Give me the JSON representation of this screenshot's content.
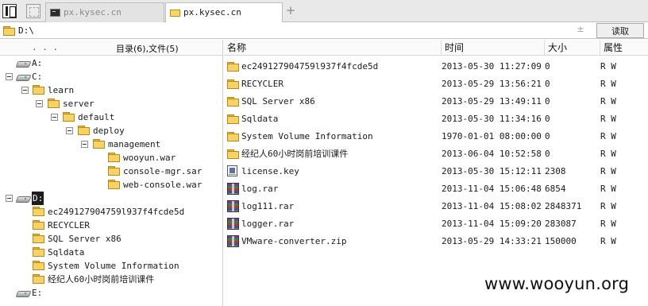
{
  "tabs": [
    {
      "label": "px.kysec.cn",
      "icon": "terminal-icon",
      "active": false
    },
    {
      "label": "px.kysec.cn",
      "icon": "folder-icon",
      "active": true
    }
  ],
  "new_tab_symbol": "+",
  "path": {
    "value": "D:\\",
    "arrows": "±",
    "read_button": "读取"
  },
  "tree_header": {
    "dots": ". . .",
    "summary": "目录(6),文件(5)"
  },
  "tree": [
    {
      "label": "A:",
      "icon": "drive-icon",
      "indent": 0,
      "toggle": false
    },
    {
      "label": "C:",
      "icon": "drive-icon",
      "indent": 0,
      "toggle": true
    },
    {
      "label": "learn",
      "icon": "folder-icon",
      "indent": 1,
      "toggle": true
    },
    {
      "label": "server",
      "icon": "folder-icon",
      "indent": 2,
      "toggle": true
    },
    {
      "label": "default",
      "icon": "folder-icon",
      "indent": 3,
      "toggle": true
    },
    {
      "label": "deploy",
      "icon": "folder-icon",
      "indent": 4,
      "toggle": true
    },
    {
      "label": "management",
      "icon": "folder-icon",
      "indent": 5,
      "toggle": true
    },
    {
      "label": "wooyun.war",
      "icon": "folder-icon",
      "indent": 6,
      "toggle": false
    },
    {
      "label": "console-mgr.sar",
      "icon": "folder-icon",
      "indent": 6,
      "toggle": false
    },
    {
      "label": "web-console.war",
      "icon": "folder-icon",
      "indent": 6,
      "toggle": false
    },
    {
      "label": "D:",
      "icon": "drive-icon",
      "indent": 0,
      "toggle": true,
      "selected": true
    },
    {
      "label": "ec249127904759l937f4fcde5d",
      "icon": "folder-icon",
      "indent": 1,
      "toggle": false
    },
    {
      "label": "RECYCLER",
      "icon": "folder-icon",
      "indent": 1,
      "toggle": false
    },
    {
      "label": "SQL Server x86",
      "icon": "folder-icon",
      "indent": 1,
      "toggle": false
    },
    {
      "label": "Sqldata",
      "icon": "folder-icon",
      "indent": 1,
      "toggle": false
    },
    {
      "label": "System Volume Information",
      "icon": "folder-icon",
      "indent": 1,
      "toggle": false
    },
    {
      "label": "经纪人60小时岗前培训课件",
      "icon": "folder-icon",
      "indent": 1,
      "toggle": false
    },
    {
      "label": "E:",
      "icon": "drive-icon",
      "indent": 0,
      "toggle": false
    }
  ],
  "columns": {
    "name": "名称",
    "time": "时间",
    "size": "大小",
    "attr": "属性"
  },
  "files": [
    {
      "name": "ec249127904759l937f4fcde5d",
      "time": "2013-05-30 11:27:09",
      "size": "0",
      "attr": "R W",
      "icon": "folder-icon"
    },
    {
      "name": "RECYCLER",
      "time": "2013-05-29 13:56:21",
      "size": "0",
      "attr": "R W",
      "icon": "folder-icon"
    },
    {
      "name": "SQL Server x86",
      "time": "2013-05-29 13:49:11",
      "size": "0",
      "attr": "R W",
      "icon": "folder-icon"
    },
    {
      "name": "Sqldata",
      "time": "2013-05-30 11:34:16",
      "size": "0",
      "attr": "R W",
      "icon": "folder-icon"
    },
    {
      "name": "System Volume Information",
      "time": "1970-01-01 08:00:00",
      "size": "0",
      "attr": "R W",
      "icon": "folder-icon"
    },
    {
      "name": "经纪人60小时岗前培训课件",
      "time": "2013-06-04 10:52:58",
      "size": "0",
      "attr": "R W",
      "icon": "folder-icon"
    },
    {
      "name": "license.key",
      "time": "2013-05-30 15:12:11",
      "size": "2308",
      "attr": "R W",
      "icon": "key-file-icon"
    },
    {
      "name": "log.rar",
      "time": "2013-11-04 15:06:48",
      "size": "6854",
      "attr": "R W",
      "icon": "rar-archive-icon"
    },
    {
      "name": "log111.rar",
      "time": "2013-11-04 15:08:02",
      "size": "2848371",
      "attr": "R W",
      "icon": "rar-archive-icon"
    },
    {
      "name": "logger.rar",
      "time": "2013-11-04 15:09:20",
      "size": "283087",
      "attr": "R W",
      "icon": "rar-archive-icon"
    },
    {
      "name": "VMware-converter.zip",
      "time": "2013-05-29 14:33:21",
      "size": "150000",
      "attr": "R W",
      "icon": "rar-archive-icon"
    }
  ],
  "watermark": "www.wooyun.org"
}
